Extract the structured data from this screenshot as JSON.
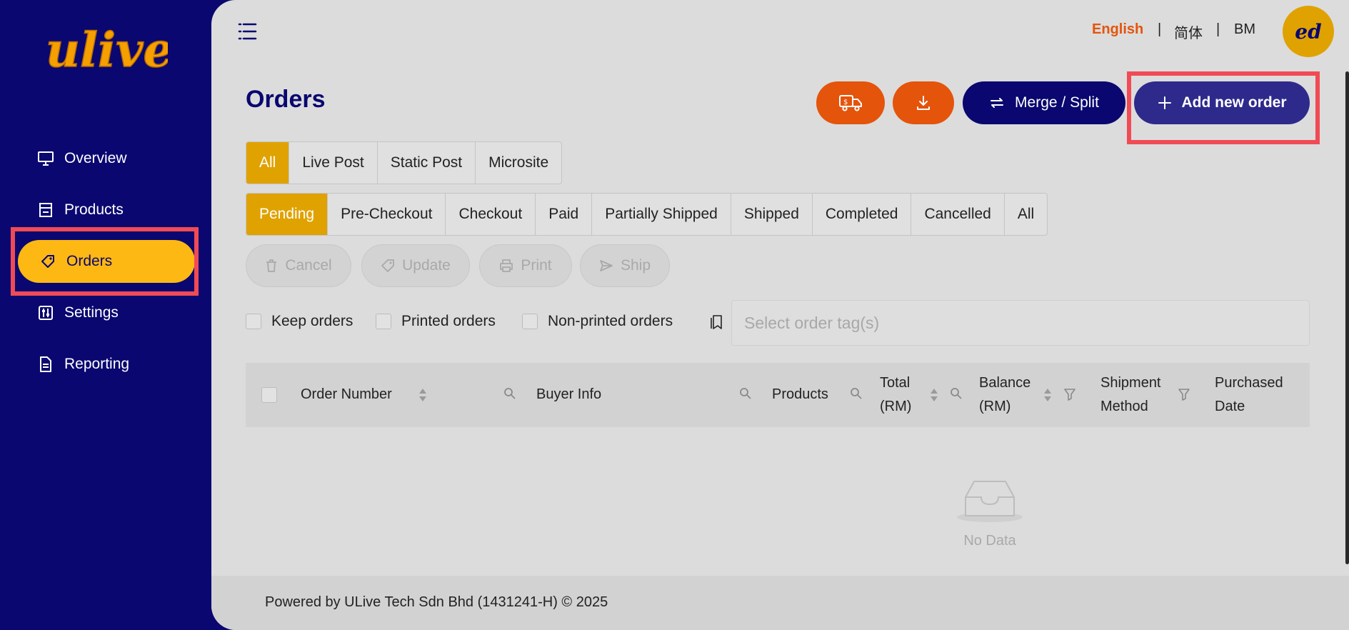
{
  "brand": {
    "logo_text": "ulive",
    "color": "#fdb813"
  },
  "sidebar": {
    "items": [
      {
        "label": "Overview",
        "icon": "monitor-icon"
      },
      {
        "label": "Products",
        "icon": "store-icon"
      },
      {
        "label": "Orders",
        "icon": "tag-icon",
        "active": true
      },
      {
        "label": "Settings",
        "icon": "sliders-icon"
      },
      {
        "label": "Reporting",
        "icon": "document-icon"
      }
    ]
  },
  "header": {
    "languages": [
      "English",
      "|",
      "简体",
      "|",
      "BM"
    ],
    "active_language": "English",
    "avatar_initials": "ed"
  },
  "page": {
    "title": "Orders",
    "buttons": {
      "shipping_icon": "truck-dollar-icon",
      "download_icon": "download-icon",
      "merge_split": "Merge / Split",
      "add_new_order": "Add new order"
    }
  },
  "source_tabs": [
    "All",
    "Live Post",
    "Static Post",
    "Microsite"
  ],
  "status_tabs": [
    "Pending",
    "Pre-Checkout",
    "Checkout",
    "Paid",
    "Partially Shipped",
    "Shipped",
    "Completed",
    "Cancelled",
    "All"
  ],
  "actions": [
    "Cancel",
    "Update",
    "Print",
    "Ship"
  ],
  "filters": {
    "checkboxes": [
      "Keep orders",
      "Printed orders",
      "Non-printed orders"
    ],
    "tag_placeholder": "Select order tag(s)"
  },
  "table": {
    "columns": {
      "order_number": "Order Number",
      "buyer_info": "Buyer Info",
      "products": "Products",
      "total_l1": "Total",
      "total_l2": "(RM)",
      "balance_l1": "Balance",
      "balance_l2": "(RM)",
      "shipment_l1": "Shipment",
      "shipment_l2": "Method",
      "purchased_l1": "Purchased",
      "purchased_l2": "Date"
    },
    "empty_text": "No Data"
  },
  "footer": {
    "text": "Powered by ULive Tech Sdn Bhd (1431241-H) © 2025"
  },
  "colors": {
    "sidebar_bg": "#0a0770",
    "accent_yellow": "#fdb813",
    "accent_orange": "#e4540b",
    "navy": "#0a0770",
    "purple": "#2e2a8c",
    "highlight_red": "#f04b55",
    "tab_active": "#e0a200"
  }
}
